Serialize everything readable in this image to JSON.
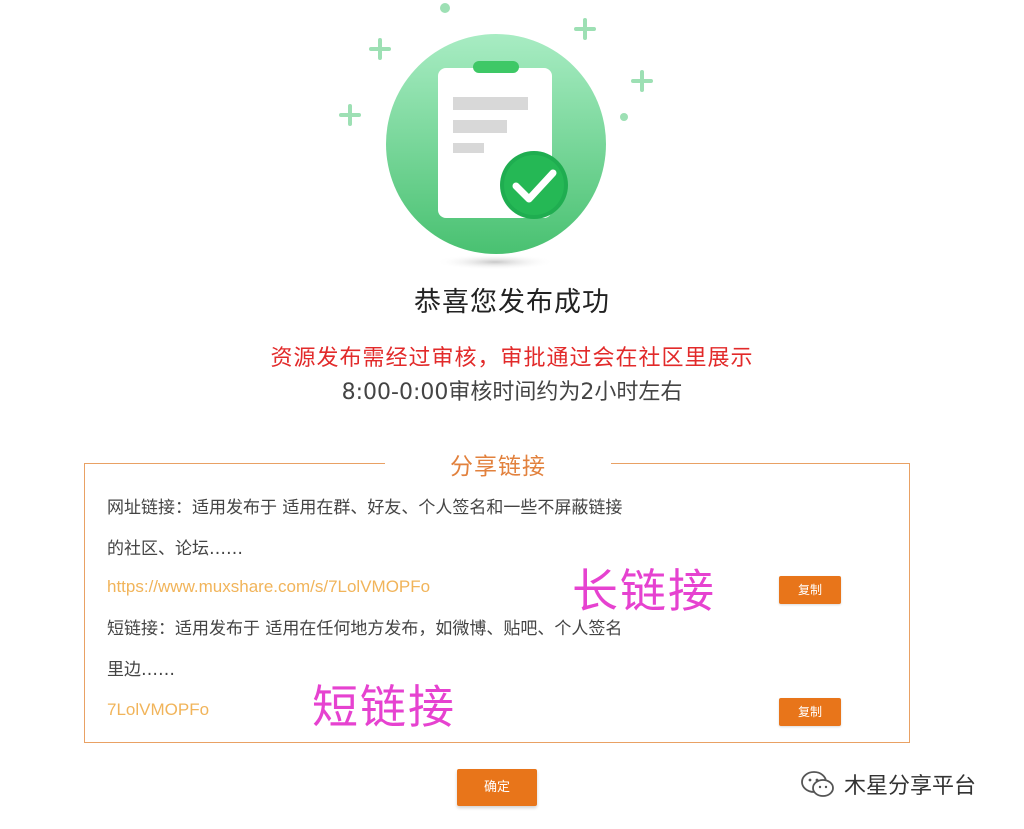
{
  "success": {
    "title": "恭喜您发布成功",
    "notice_red": "资源发布需经过审核，审批通过会在社区里展示",
    "notice_gray": "8:00-0:00审核时间约为2小时左右"
  },
  "share": {
    "title": "分享链接",
    "long": {
      "desc_line1": "网址链接：适用发布于 适用在群、好友、个人签名和一些不屏蔽链接",
      "desc_line2": "的社区、论坛……",
      "url": "https://www.muxshare.com/s/7LolVMOPFo",
      "copy_label": "复制"
    },
    "short": {
      "desc_line1": "短链接：适用发布于 适用在任何地方发布，如微博、贴吧、个人签名",
      "desc_line2": "里边……",
      "code": "7LolVMOPFo",
      "copy_label": "复制"
    }
  },
  "annotations": {
    "long_label": "长链接",
    "short_label": "短链接"
  },
  "confirm_label": "确定",
  "watermark": {
    "text": "木星分享平台"
  },
  "colors": {
    "accent_orange": "#e8751a",
    "error_red": "#e22a2a",
    "annotation_pink": "#e642d0",
    "success_green": "#3cc45e",
    "link_gold": "#f1b45a"
  },
  "icons": {
    "hero": "clipboard-checkmark-icon",
    "watermark": "wechat-official-account-icon"
  }
}
